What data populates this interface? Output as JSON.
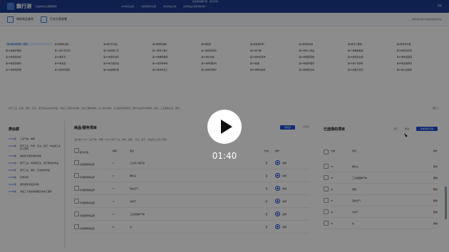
{
  "header": {
    "logo_text": "飘行测",
    "logo_sub": "让品牌商标注册更简单！",
    "notice": "欢迎使用飘行测 · 商标查询",
    "links": [
      "市场商标注册",
      "马德里商标注册",
      "商标商品分类",
      "全球商品分类查询系统 ▾"
    ],
    "right": "登录"
  },
  "subnav": {
    "left_label": "商标商品查询",
    "mid_label": "行业分类查看",
    "right_text": "搜索商标用户名或商品相关标签"
  },
  "categories": {
    "items": [
      "第1类化学原料、肥料",
      "第2类颜料油漆",
      "第3类日化用品",
      "第4类燃料油脂",
      "第5类医药",
      "第6类金属材料",
      "第7类机械设备",
      "第8类手工器械",
      "第9类科学仪器",
      "第10类医疗器械",
      "第11类灯具空调",
      "第12类运输工具",
      "第13类军火烟火",
      "第14类珠宝钟表",
      "第15类乐器",
      "第16类办公用品",
      "第17类橡胶制品",
      "第18类皮革皮具",
      "第19类建筑材料",
      "第20类家具",
      "第21类厨房洁具",
      "第22类绳网袋篷",
      "第23类纱线丝",
      "第24类布料床单",
      "第25类服装鞋帽",
      "第26类纽扣拉链",
      "第27类地毯席垫",
      "第28类健身器材",
      "第29类食品",
      "第30类方便食品",
      "第31类饲料种籽",
      "第32类啤酒饮料",
      "第33类酒",
      "第34类烟草烟具",
      "第35类广告销售",
      "第36类金融物管",
      "第37类建筑修理",
      "第38类通讯服务",
      "第39类运输贮藏",
      "第40类材料加工",
      "第41类教育娱乐",
      "第42类网站服务",
      "第43类餐饮住宿",
      "第44类医疗园艺",
      "第45类社会服务"
    ],
    "active_index": 0,
    "note": "用于工业、科学、摄影、农业、园艺和林业的化学品；未加工人造合成树脂；未加工塑料物质；灭火用合成物；淬火和焊接用制剂；保存食品用化学物质；鞣料；工业用粘合剂；肥料。",
    "right_text": "展开 ∨"
  },
  "left_panel": {
    "title": "类似群",
    "groups": [
      {
        "tag": "0101组",
        "desc": "工业气体，单质"
      },
      {
        "tag": "0102组",
        "desc": "用于工业、科学、农业、园艺、林业的工业化工原料"
      },
      {
        "tag": "0103组",
        "desc": "放射性元素及其化学品"
      },
      {
        "tag": "0104组",
        "desc": "用于工业、科学和农业、园艺等的化学品"
      },
      {
        "tag": "0105组",
        "desc": "用于工业、摄影、农业的化学品"
      },
      {
        "tag": "0106组",
        "desc": "化学试剂"
      },
      {
        "tag": "0107组",
        "desc": "摄影用化学品及材料"
      },
      {
        "tag": "0108组",
        "desc": "未加工人造合成树脂及未加工塑料"
      }
    ]
  },
  "mid_panel": {
    "title": "商品/服务项目",
    "btn_primary": "按组选",
    "btn_secondary": "已标记",
    "sub": "[第1类] 0101 工业气体，单质 / 0102 用于工业、科学、摄影、农业、园艺、林业的工业化工原料",
    "head": {
      "c1": "官方标准",
      "c2": "编码",
      "c3": "项目",
      "c4": "状态",
      "c5": "操作"
    },
    "rows": [
      {
        "c1": "标准官网商品项",
        "c2": "1",
        "c3": "工业用人造石墨",
        "c4": "否",
        "c5": "选择"
      },
      {
        "c1": "标准官网商品项",
        "c2": "2",
        "c3": "碳化氢",
        "c4": "否",
        "c5": "选择"
      },
      {
        "c1": "标准官网商品项",
        "c2": "3",
        "c3": "液态空气",
        "c4": "否",
        "c5": "选择"
      },
      {
        "c1": "标准官网商品项",
        "c2": "4",
        "c3": "水煤气",
        "c4": "否",
        "c5": "选择"
      },
      {
        "c1": "标准官网商品项",
        "c2": "5",
        "c3": "工业用固体气体",
        "c4": "否",
        "c5": "选择"
      },
      {
        "c1": "标准官网商品项",
        "c2": "6",
        "c3": "氧",
        "c4": "否",
        "c5": "选择"
      }
    ]
  },
  "right_panel": {
    "title": "已选择的项目",
    "actions": [
      "清空",
      "重选"
    ],
    "btn": "生成商标方案",
    "head": {
      "c1": "",
      "c2": "分类",
      "c3": "项目",
      "c4": "操作"
    },
    "rows": [
      {
        "c2": "01",
        "c3": "碳化氢",
        "c4": "删除"
      },
      {
        "c2": "01",
        "c3": "工业用固体气体",
        "c4": "删除"
      },
      {
        "c2": "01",
        "c3": "硫酸",
        "c4": "删除"
      },
      {
        "c2": "01",
        "c3": "液态空气",
        "c4": "删除"
      },
      {
        "c2": "01",
        "c3": "水煤气",
        "c4": "删除"
      },
      {
        "c2": "01",
        "c3": "氧",
        "c4": "删除"
      }
    ]
  },
  "video": {
    "time": "01:40"
  },
  "colors": {
    "brand": "#1d3b8f",
    "accent": "#1d4ed8"
  }
}
